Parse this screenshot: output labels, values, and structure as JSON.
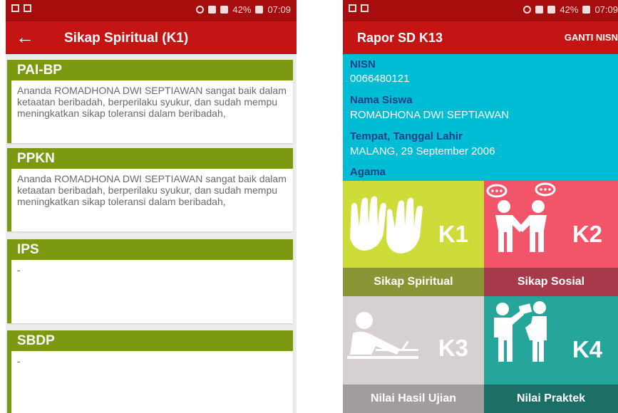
{
  "left_screen": {
    "status": {
      "time": "07:09",
      "battery": "42%"
    },
    "appbar": {
      "back_icon": "arrow-left-icon",
      "title": "Sikap Spiritual (K1)"
    },
    "cards": [
      {
        "subject": "PAI-BP",
        "description": "Ananda ROMADHONA DWI SEPTIAWAN sangat baik dalam ketaatan beribadah, berperilaku syukur, dan sudah mempu meningkatkan sikap toleransi dalam beribadah,"
      },
      {
        "subject": "PPKN",
        "description": "Ananda ROMADHONA DWI SEPTIAWAN sangat baik dalam ketaatan beribadah, berperilaku syukur, dan sudah mempu meningkatkan sikap toleransi dalam beribadah,"
      },
      {
        "subject": "IPS",
        "description": "-"
      },
      {
        "subject": "SBDP",
        "description": "-"
      }
    ]
  },
  "right_screen": {
    "status": {
      "time": "07:09",
      "battery": "42%"
    },
    "appbar": {
      "title": "Rapor SD K13",
      "action": "GANTI NISN"
    },
    "student": {
      "nisn_label": "NISN",
      "nisn": "0066480121",
      "name_label": "Nama Siswa",
      "name": "ROMADHONA DWI SEPTIAWAN",
      "birth_label": "Tempat, Tanggal Lahir",
      "birth": "MALANG, 29 September 2006",
      "religion_label": "Agama"
    },
    "tiles": [
      {
        "code": "K1",
        "caption": "Sikap Spiritual",
        "icon": "praying-hands-icon",
        "bg": "#cddc39",
        "cap_bg": "#8a9636"
      },
      {
        "code": "K2",
        "caption": "Sikap Sosial",
        "icon": "handshake-talk-icon",
        "bg": "#f2546a",
        "cap_bg": "#a63a4b"
      },
      {
        "code": "K3",
        "caption": "Nilai Hasil Ujian",
        "icon": "student-writing-icon",
        "bg": "#d6d0d0",
        "cap_bg": "#a29d9d"
      },
      {
        "code": "K4",
        "caption": "Nilai Praktek",
        "icon": "teacher-student-icon",
        "bg": "#26a69a",
        "cap_bg": "#1c6f67"
      }
    ]
  }
}
